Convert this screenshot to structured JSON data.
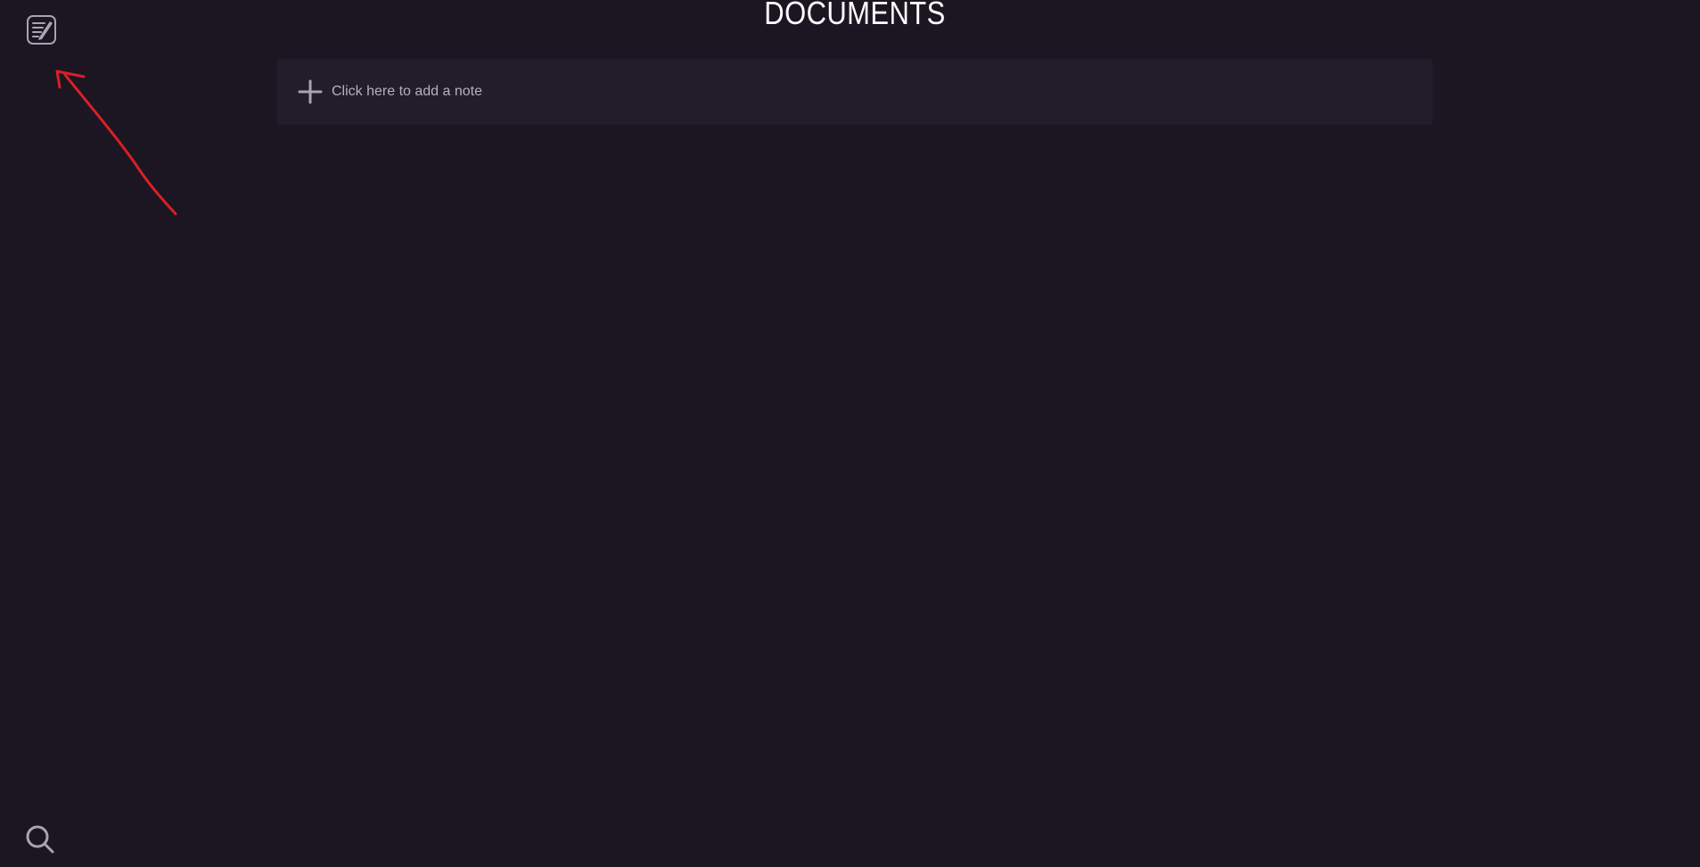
{
  "header": {
    "title": "DOCUMENTS"
  },
  "sidebar": {
    "top_icon": "notes-icon",
    "bottom_icon": "search-icon"
  },
  "main": {
    "add_note_label": "Click here to add a note",
    "add_note_icon": "plus-icon"
  },
  "annotation": {
    "type": "red-arrow",
    "color": "#d91f26"
  },
  "colors": {
    "background": "#1b1621",
    "panel": "#221d2a",
    "title": "#ffffff",
    "muted_text": "#b6b0bd",
    "icon": "#aaa4b2"
  }
}
